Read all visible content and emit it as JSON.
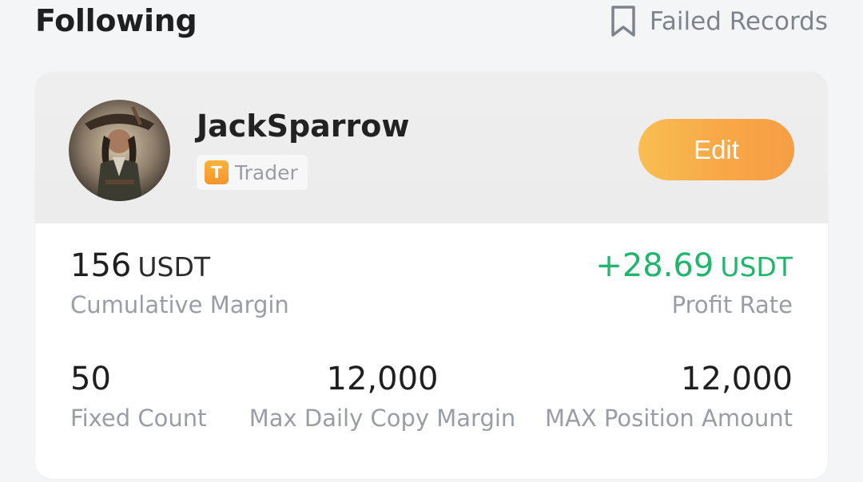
{
  "header": {
    "title": "Following",
    "failed_records_label": "Failed Records"
  },
  "trader": {
    "name": "JackSparrow",
    "badge_letter": "T",
    "badge_label": "Trader",
    "edit_label": "Edit"
  },
  "stats": {
    "cumulative_margin": {
      "value": "156",
      "unit": "USDT",
      "label": "Cumulative Margin"
    },
    "profit_rate": {
      "value": "+28.69",
      "unit": "USDT",
      "label": "Profit Rate"
    },
    "fixed_count": {
      "value": "50",
      "label": "Fixed Count"
    },
    "max_daily_copy_margin": {
      "value": "12,000",
      "label": "Max Daily Copy Margin"
    },
    "max_position_amount": {
      "value": "12,000",
      "label": "MAX Position Amount"
    }
  },
  "colors": {
    "accent_orange": "#f8a746",
    "profit_green": "#20b66e",
    "muted_text": "#9a9ea4"
  },
  "icons": {
    "failed_records": "bookmark-icon",
    "avatar": "avatar-image",
    "badge": "trader-badge-icon"
  }
}
